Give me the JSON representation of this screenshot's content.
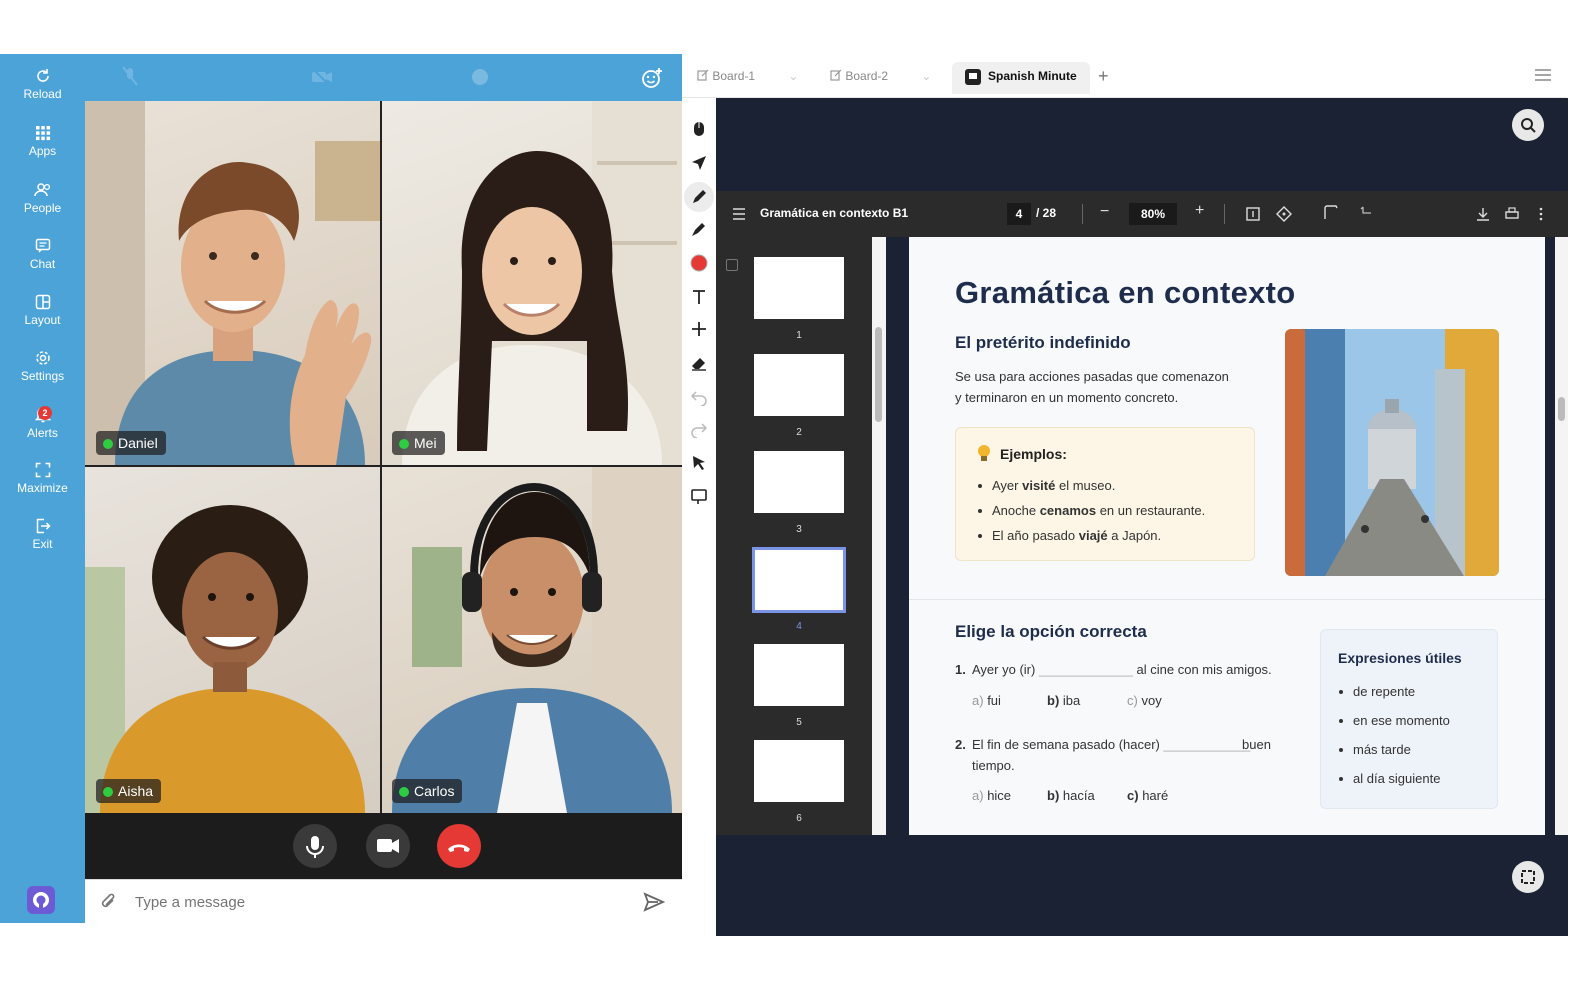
{
  "sidebar": {
    "items": [
      {
        "label": "Reload",
        "icon": "reload-icon"
      },
      {
        "label": "Apps",
        "icon": "apps-icon"
      },
      {
        "label": "People",
        "icon": "people-icon"
      },
      {
        "label": "Chat",
        "icon": "chat-icon"
      },
      {
        "label": "Layout",
        "icon": "layout-icon"
      },
      {
        "label": "Settings",
        "icon": "settings-icon"
      },
      {
        "label": "Alerts",
        "icon": "bell-icon",
        "badge": "2"
      },
      {
        "label": "Maximize",
        "icon": "maximize-icon"
      },
      {
        "label": "Exit",
        "icon": "exit-icon"
      }
    ]
  },
  "video": {
    "participants": [
      {
        "name": "Daniel"
      },
      {
        "name": "Mei"
      },
      {
        "name": "Aisha"
      },
      {
        "name": "Carlos"
      }
    ]
  },
  "chat": {
    "placeholder": "Type a message"
  },
  "tabs": [
    {
      "label": "Board-1"
    },
    {
      "label": "Board-2"
    },
    {
      "label": "Spanish Minute"
    }
  ],
  "pdf": {
    "title": "Gramática en contexto B1",
    "current_page": "4",
    "total_pages": "/ 28",
    "zoom": "80%",
    "thumbnails": [
      "1",
      "2",
      "3",
      "4",
      "5",
      "6"
    ]
  },
  "page": {
    "heading": "Gramática en contexto",
    "section1_title": "El pretérito indefinido",
    "section1_line1": "Se usa para acciones pasadas que comenazon",
    "section1_line2": "y terminaron en un momento concreto.",
    "examples_title": "Ejemplos:",
    "ex1_a": "Ayer ",
    "ex1_b": "visité",
    "ex1_c": " el museo.",
    "ex2_a": "Anoche ",
    "ex2_b": "cenamos",
    "ex2_c": " en un restaurante.",
    "ex3_a": "El año pasado ",
    "ex3_b": "viajé",
    "ex3_c": " a Japón.",
    "section2_title": "Elige la opción correcta",
    "q1_num": "1.",
    "q1_a": "Ayer yo (ir) ",
    "q1_blank": "_____________",
    "q1_b": " al cine con mis amigos.",
    "q1_opts": [
      {
        "l": "a)",
        "t": "fui"
      },
      {
        "l": "b)",
        "t": "iba"
      },
      {
        "l": "c)",
        "t": "voy"
      }
    ],
    "q2_num": "2.",
    "q2_a": "El fin de semana pasado (hacer) ",
    "q2_blank": "____________",
    "q2_b": "buen",
    "q2_c": "tiempo.",
    "q2_opts": [
      {
        "l": "a)",
        "t": "hice"
      },
      {
        "l": "b)",
        "t": "hacía"
      },
      {
        "l": "c)",
        "t": "haré"
      }
    ],
    "useful_title": "Expresiones útiles",
    "useful": [
      "de repente",
      "en ese momento",
      "más tarde",
      "al día siguiente"
    ]
  },
  "colors": {
    "sidebar": "#4ba3d8",
    "hangup": "#e53935",
    "heading": "#1f2d4d",
    "board": "#1b2233"
  }
}
